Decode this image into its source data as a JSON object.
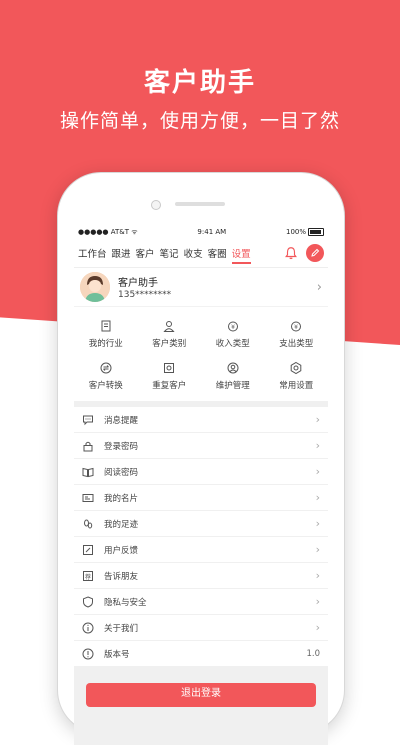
{
  "hero": {
    "title": "客户助手",
    "subtitle": "操作简单，使用方便，一目了然"
  },
  "status_bar": {
    "carrier": "●●●●● AT&T ᯤ",
    "time": "9:41 AM",
    "battery": "100%"
  },
  "tabs": [
    {
      "label": "工作台",
      "active": false
    },
    {
      "label": "跟进",
      "active": false
    },
    {
      "label": "客户",
      "active": false
    },
    {
      "label": "笔记",
      "active": false
    },
    {
      "label": "收支",
      "active": false
    },
    {
      "label": "客圈",
      "active": false
    },
    {
      "label": "设置",
      "active": true
    }
  ],
  "profile": {
    "name": "客户助手",
    "phone": "135********"
  },
  "grid": [
    {
      "label": "我的行业",
      "icon": "book-icon"
    },
    {
      "label": "客户类别",
      "icon": "person-icon"
    },
    {
      "label": "收入类型",
      "icon": "income-icon"
    },
    {
      "label": "支出类型",
      "icon": "expense-icon"
    },
    {
      "label": "客户转换",
      "icon": "transfer-icon"
    },
    {
      "label": "重复客户",
      "icon": "duplicate-icon"
    },
    {
      "label": "维护管理",
      "icon": "maintain-icon"
    },
    {
      "label": "常用设置",
      "icon": "settings-icon"
    }
  ],
  "settings_list": [
    {
      "label": "消息提醒",
      "icon": "message-icon"
    },
    {
      "label": "登录密码",
      "icon": "lock-icon"
    },
    {
      "label": "阅读密码",
      "icon": "reading-icon"
    },
    {
      "label": "我的名片",
      "icon": "card-icon"
    },
    {
      "label": "我的足迹",
      "icon": "footprint-icon"
    },
    {
      "label": "用户反馈",
      "icon": "feedback-icon"
    },
    {
      "label": "告诉朋友",
      "icon": "share-icon"
    },
    {
      "label": "隐私与安全",
      "icon": "shield-icon"
    },
    {
      "label": "关于我们",
      "icon": "info-icon"
    }
  ],
  "version": {
    "label": "版本号",
    "value": "1.0",
    "icon": "alert-icon"
  },
  "logout": {
    "label": "退出登录"
  },
  "colors": {
    "accent": "#f2575a"
  }
}
